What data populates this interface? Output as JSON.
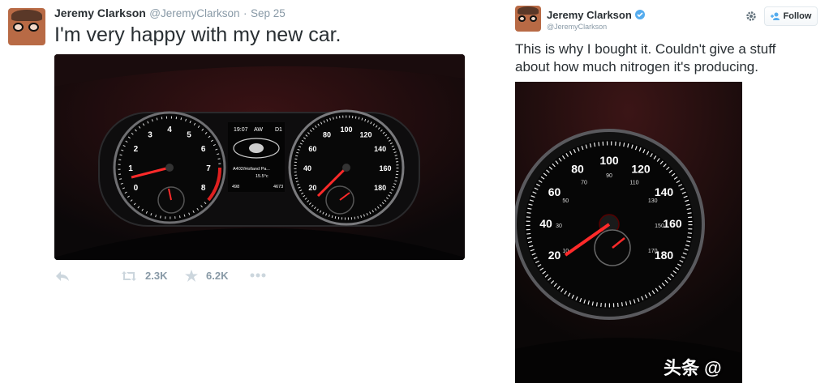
{
  "left_tweet": {
    "name": "Jeremy Clarkson",
    "handle": "@JeremyClarkson",
    "separator": "·",
    "date": "Sep 25",
    "text": "I'm very happy with my new car.",
    "retweet_count": "2.3K",
    "favorite_count": "6.2K",
    "dash": {
      "time": "19:07",
      "drive": "AW",
      "gear": "D1",
      "road": "A402/Holland Pa...",
      "temp": "15.5°c",
      "km": "498",
      "odo": "4673"
    },
    "rpm_labels": [
      "0",
      "1",
      "2",
      "3",
      "4",
      "5",
      "6",
      "7",
      "8"
    ],
    "speed_labels": [
      "20",
      "40",
      "60",
      "80",
      "100",
      "120",
      "140",
      "160",
      "180"
    ]
  },
  "right_tweet": {
    "name": "Jeremy Clarkson",
    "handle": "@JeremyClarkson",
    "follow_label": "Follow",
    "text_line1": "This is why I bought it. Couldn't give a stuff",
    "text_line2": "about how much nitrogen it's producing.",
    "speed_labels": [
      "20",
      "40",
      "60",
      "80",
      "100",
      "120",
      "140",
      "160",
      "180"
    ],
    "small_labels": [
      "10",
      "30",
      "50",
      "70",
      "90",
      "110",
      "130",
      "150",
      "170"
    ],
    "watermark": "头条 @"
  },
  "colors": {
    "needle": "#ff2a2a",
    "verified": "#55acee",
    "muted": "#8899a6"
  },
  "icons": [
    "reply-icon",
    "retweet-icon",
    "favorite-icon",
    "more-icon",
    "gear-icon",
    "follow-person-icon",
    "verified-icon"
  ]
}
